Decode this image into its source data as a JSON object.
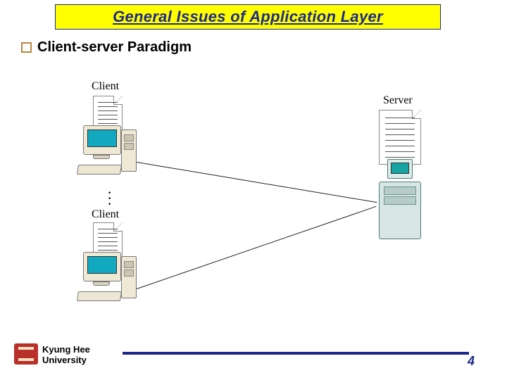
{
  "title": "General Issues of Application Layer",
  "bullet": "Client-server Paradigm",
  "diagram": {
    "client_label_top": "Client",
    "client_label_bottom": "Client",
    "server_label": "Server",
    "ellipsis": "⋮"
  },
  "footer": {
    "institution_line1": "Kyung Hee",
    "institution_line2": "University",
    "page": "4"
  }
}
